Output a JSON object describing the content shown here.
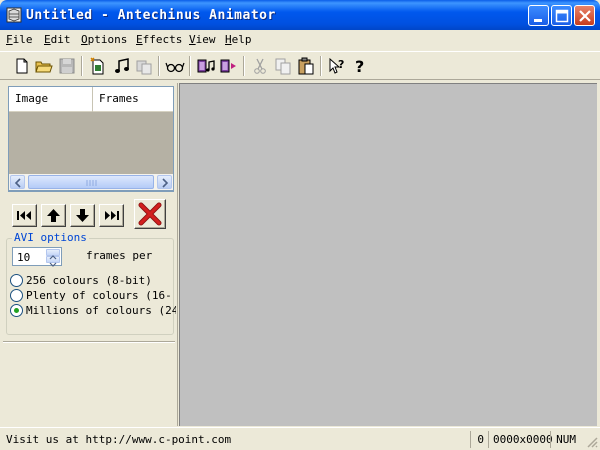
{
  "window": {
    "title": "Untitled - Antechinus Animator",
    "controls": [
      "minimize-icon",
      "maximize-icon",
      "close-icon"
    ]
  },
  "menu": {
    "items": [
      {
        "label": "File",
        "mnemonic": "F",
        "rest": "ile"
      },
      {
        "label": "Edit",
        "mnemonic": "E",
        "rest": "dit"
      },
      {
        "label": "Options",
        "mnemonic": "O",
        "rest": "ptions"
      },
      {
        "label": "Effects",
        "mnemonic": "E",
        "rest": "ffects"
      },
      {
        "label": "View",
        "mnemonic": "V",
        "rest": "iew"
      },
      {
        "label": "Help",
        "mnemonic": "H",
        "rest": "elp"
      }
    ]
  },
  "toolbar": {
    "icons": [
      "new-file-icon",
      "open-folder-icon",
      "save-icon",
      "import-image-icon",
      "music-icon",
      "insert-frames-icon",
      "preview-glasses-icon",
      "insert-music-icon",
      "export-icon",
      "cut-icon",
      "copy-icon",
      "paste-icon",
      "context-help-icon",
      "help-icon"
    ]
  },
  "frame_list": {
    "columns": [
      "Image",
      "Frames"
    ],
    "rows": []
  },
  "navigation": {
    "icons": [
      "first-frame-icon",
      "move-up-icon",
      "move-down-icon",
      "last-frame-icon",
      "delete-icon"
    ]
  },
  "avi_options": {
    "label": "AVI options",
    "frames_value": "10",
    "frames_label": "frames per",
    "colour_options": [
      {
        "label": "256 colours (8-bit)",
        "checked": false
      },
      {
        "label": "Plenty of colours (16-",
        "checked": false
      },
      {
        "label": "Millions of colours (24",
        "checked": true
      }
    ]
  },
  "status": {
    "message": "Visit us at http://www.c-point.com",
    "count": "0",
    "dimensions": "0000x0000",
    "num": "NUM"
  },
  "colors": {
    "titlebar": "#0054e3",
    "canvas": "#c0c0c0",
    "face": "#ece9d8",
    "group_label": "#0046d5",
    "delete_red": "#d21f1f"
  }
}
